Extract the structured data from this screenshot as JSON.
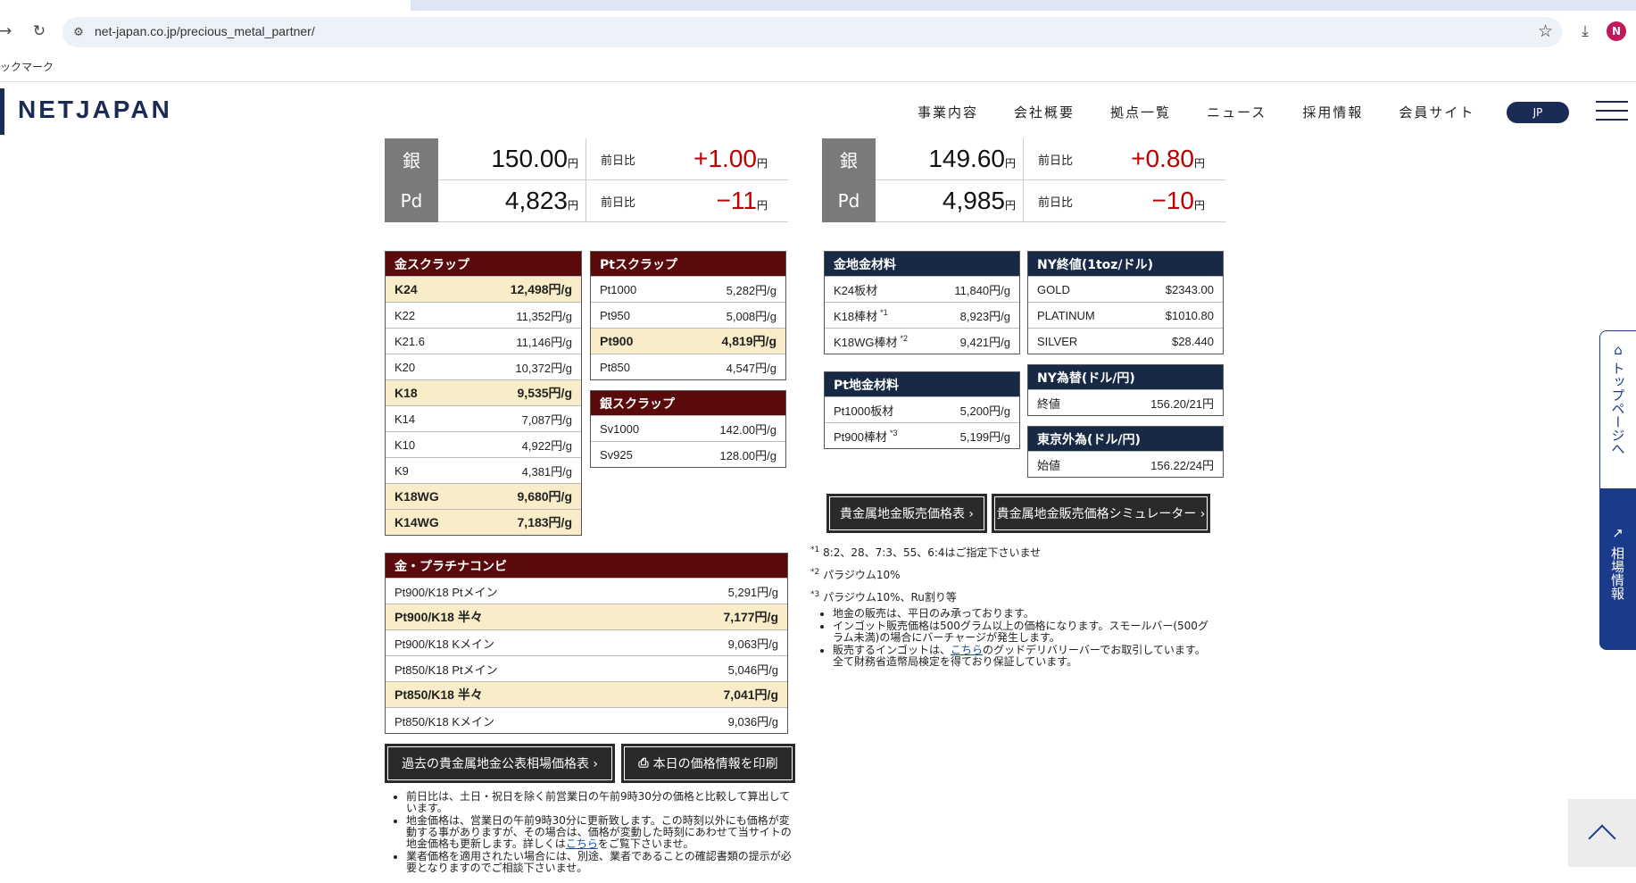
{
  "browser": {
    "url": "net-japan.co.jp/precious_metal_partner/",
    "bookmark_label": "ックマーク",
    "avatar_letter": "N"
  },
  "site": {
    "logo": "NETJAPAN",
    "nav": [
      "事業内容",
      "会社概要",
      "拠点一覧",
      "ニュース",
      "採用情報",
      "会員サイト"
    ],
    "lang_button": "JP"
  },
  "left_prices": [
    {
      "metal": "銀",
      "price": "150.00",
      "diff_label": "前日比",
      "diff": "+1.00",
      "yen": "円"
    },
    {
      "metal": "Pd",
      "price": "4,823",
      "diff_label": "前日比",
      "diff": "−11",
      "yen": "円"
    }
  ],
  "right_prices": [
    {
      "metal": "銀",
      "price": "149.60",
      "diff_label": "前日比",
      "diff": "+0.80",
      "yen": "円"
    },
    {
      "metal": "Pd",
      "price": "4,985",
      "diff_label": "前日比",
      "diff": "−10",
      "yen": "円"
    }
  ],
  "gold_scrap": {
    "title": "金スクラップ",
    "rows": [
      {
        "name": "K24",
        "price": "12,498円/g",
        "hl": true
      },
      {
        "name": "K22",
        "price": "11,352円/g",
        "hl": false
      },
      {
        "name": "K21.6",
        "price": "11,146円/g",
        "hl": false
      },
      {
        "name": "K20",
        "price": "10,372円/g",
        "hl": false
      },
      {
        "name": "K18",
        "price": "9,535円/g",
        "hl": true
      },
      {
        "name": "K14",
        "price": "7,087円/g",
        "hl": false
      },
      {
        "name": "K10",
        "price": "4,922円/g",
        "hl": false
      },
      {
        "name": "K9",
        "price": "4,381円/g",
        "hl": false
      },
      {
        "name": "K18WG",
        "price": "9,680円/g",
        "hl": true
      },
      {
        "name": "K14WG",
        "price": "7,183円/g",
        "hl": true
      }
    ]
  },
  "pt_scrap": {
    "title": "Ptスクラップ",
    "rows": [
      {
        "name": "Pt1000",
        "price": "5,282円/g",
        "hl": false
      },
      {
        "name": "Pt950",
        "price": "5,008円/g",
        "hl": false
      },
      {
        "name": "Pt900",
        "price": "4,819円/g",
        "hl": true
      },
      {
        "name": "Pt850",
        "price": "4,547円/g",
        "hl": false
      }
    ]
  },
  "silver_scrap": {
    "title": "銀スクラップ",
    "rows": [
      {
        "name": "Sv1000",
        "price": "142.00円/g"
      },
      {
        "name": "Sv925",
        "price": "128.00円/g"
      }
    ]
  },
  "combo": {
    "title": "金・プラチナコンビ",
    "rows": [
      {
        "name": "Pt900/K18 Ptメイン",
        "price": "5,291円/g",
        "hl": false
      },
      {
        "name": "Pt900/K18 半々",
        "price": "7,177円/g",
        "hl": true
      },
      {
        "name": "Pt900/K18 Kメイン",
        "price": "9,063円/g",
        "hl": false
      },
      {
        "name": "Pt850/K18 Ptメイン",
        "price": "5,046円/g",
        "hl": false
      },
      {
        "name": "Pt850/K18 半々",
        "price": "7,041円/g",
        "hl": true
      },
      {
        "name": "Pt850/K18 Kメイン",
        "price": "9,036円/g",
        "hl": false
      }
    ]
  },
  "gold_material": {
    "title": "金地金材料",
    "rows": [
      {
        "name": "K24板材",
        "sup": "",
        "price": "11,840円/g"
      },
      {
        "name": "K18棒材",
        "sup": "*1",
        "price": "8,923円/g"
      },
      {
        "name": "K18WG棒材",
        "sup": "*2",
        "price": "9,421円/g"
      }
    ]
  },
  "pt_material": {
    "title": "Pt地金材料",
    "rows": [
      {
        "name": "Pt1000板材",
        "sup": "",
        "price": "5,200円/g"
      },
      {
        "name": "Pt900棒材",
        "sup": "*3",
        "price": "5,199円/g"
      }
    ]
  },
  "ny_close": {
    "title": "NY終値(1toz/ドル)",
    "rows": [
      {
        "name": "GOLD",
        "price": "$2343.00"
      },
      {
        "name": "PLATINUM",
        "price": "$1010.80"
      },
      {
        "name": "SILVER",
        "price": "$28.440"
      }
    ]
  },
  "ny_fx": {
    "title": "NY為替(ドル/円)",
    "rows": [
      {
        "name": "終値",
        "price": "156.20/21円"
      }
    ]
  },
  "tokyo_fx": {
    "title": "東京外為(ドル/円)",
    "rows": [
      {
        "name": "始値",
        "price": "156.22/24円"
      }
    ]
  },
  "buttons": {
    "sale_table": "貴金属地金販売価格表 ›",
    "simulator": "貴金属地金販売価格シミュレーター ›",
    "past_prices": "過去の貴金属地金公表相場価格表 ›",
    "print": "本日の価格情報を印刷"
  },
  "footnotes": {
    "f1_mark": "*1",
    "f1": "8:2、28、7:3、55、6:4はご指定下さいませ",
    "f2_mark": "*2",
    "f2": "パラジウム10%",
    "f3_mark": "*3",
    "f3": "パラジウム10%、Ru割り等"
  },
  "right_notes": [
    "地金の販売は、平日のみ承っております。",
    "インゴット販売価格は500グラム以上の価格になります。スモールバー(500グラム未満)の場合にバーチャージが発生します。",
    "販売するインゴットは、",
    "こちら",
    "のグッドデリバリーバーでお取引しています。全て財務省造幣局検定を得ており保証しています。"
  ],
  "left_notes": [
    "前日比は、土日・祝日を除く前営業日の午前9時30分の価格と比較して算出しています。",
    "地金価格は、営業日の午前9時30分に更新致します。この時刻以外にも価格が変動する事がありますが、その場合は、価格が変動した時刻にあわせて当サイトの地金価格も更新します。詳しくは",
    "こちら",
    "をご覧下さいませ。",
    "業者価格を適用されたい場合には、別途、業者であることの確認書類の提示が必要となりますのでご相談下さいませ。"
  ],
  "side": {
    "top_page": "トップページへ",
    "market": "相場情報"
  }
}
